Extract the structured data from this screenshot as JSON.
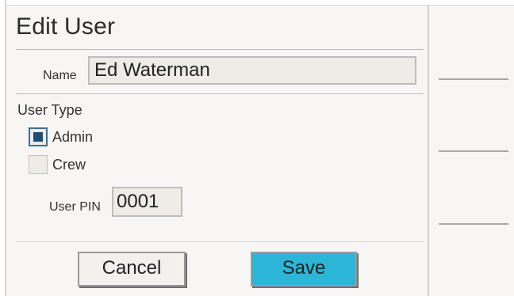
{
  "dialog": {
    "title": "Edit User"
  },
  "name_field": {
    "label": "Name",
    "value": "Ed Waterman"
  },
  "user_type": {
    "label": "User Type",
    "options": [
      {
        "label": "Admin",
        "checked": true
      },
      {
        "label": "Crew",
        "checked": false
      }
    ]
  },
  "pin_field": {
    "label": "User PIN",
    "value": "0001"
  },
  "buttons": {
    "cancel": "Cancel",
    "save": "Save"
  },
  "colors": {
    "save_button": "#2bb6d8",
    "checkbox_mark": "#1b4f7a",
    "field_background": "#efebe6"
  }
}
